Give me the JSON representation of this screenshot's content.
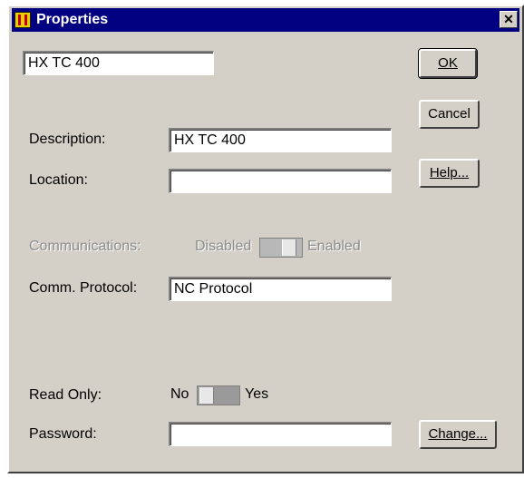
{
  "window": {
    "title": "Properties",
    "close_glyph": "✕"
  },
  "name_field": {
    "value": "HX TC 400"
  },
  "buttons": {
    "ok": "OK",
    "cancel": "Cancel",
    "help": "Help...",
    "change": "Change..."
  },
  "description": {
    "label": "Description:",
    "value": "HX TC 400"
  },
  "location": {
    "label": "Location:",
    "value": ""
  },
  "communications": {
    "label": "Communications:",
    "off_label": "Disabled",
    "on_label": "Enabled",
    "state": "disabled"
  },
  "comm_protocol": {
    "label": "Comm. Protocol:",
    "value": "NC Protocol"
  },
  "read_only": {
    "label": "Read Only:",
    "off_label": "No",
    "on_label": "Yes",
    "state": "No"
  },
  "password": {
    "label": "Password:",
    "value": ""
  },
  "icons": {
    "app": "app-icon",
    "close": "close-icon"
  }
}
